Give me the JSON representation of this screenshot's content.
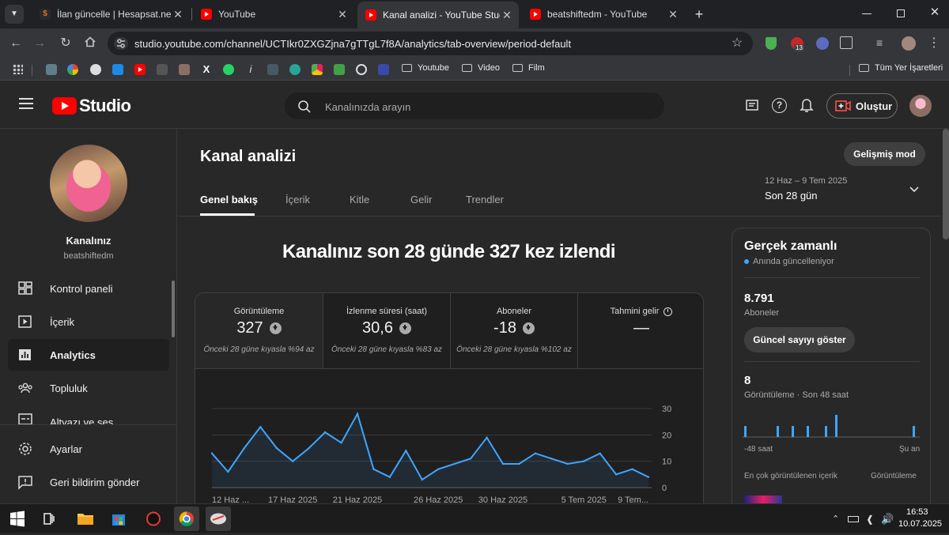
{
  "browser": {
    "tabs": [
      {
        "title": "İlan güncelle | Hesapsat.net",
        "favicon": "hesapsat-icon",
        "active": false
      },
      {
        "title": "YouTube",
        "favicon": "youtube-icon",
        "active": false
      },
      {
        "title": "Kanal analizi - YouTube Studio",
        "favicon": "youtube-icon",
        "active": true
      },
      {
        "title": "beatshiftedm - YouTube",
        "favicon": "youtube-icon",
        "active": false
      }
    ],
    "url": "studio.youtube.com/channel/UCTIkr0ZXGZjna7gTTgL7f8A/analytics/tab-overview/period-default",
    "extension_badge": "13",
    "bookmark_folders": [
      "Youtube",
      "Video",
      "Film"
    ],
    "all_bookmarks_label": "Tüm Yer İşaretleri"
  },
  "studio": {
    "logo_text": "Studio",
    "search_placeholder": "Kanalınızda arayın",
    "create_label": "Oluştur"
  },
  "sidebar": {
    "channel_title": "Kanalınız",
    "channel_handle": "beatshiftedm",
    "items": [
      {
        "label": "Kontrol paneli",
        "icon": "dashboard-icon"
      },
      {
        "label": "İçerik",
        "icon": "content-icon"
      },
      {
        "label": "Analytics",
        "icon": "analytics-icon"
      },
      {
        "label": "Topluluk",
        "icon": "community-icon"
      },
      {
        "label": "Altyazı ve ses",
        "icon": "subtitles-icon"
      }
    ],
    "bottom_items": [
      {
        "label": "Ayarlar",
        "icon": "gear-icon"
      },
      {
        "label": "Geri bildirim gönder",
        "icon": "feedback-icon"
      }
    ]
  },
  "main": {
    "page_title": "Kanal analizi",
    "advanced_mode_label": "Gelişmiş mod",
    "tabs": [
      "Genel bakış",
      "İçerik",
      "Kitle",
      "Gelir",
      "Trendler"
    ],
    "period_range": "12 Haz – 9 Tem 2025",
    "period_label": "Son 28 gün",
    "headline": "Kanalınız son 28 günde 327 kez izlendi",
    "metrics": [
      {
        "label": "Görüntüleme",
        "value": "327",
        "compare": "Önceki 28 güne kıyasla %94 az"
      },
      {
        "label": "İzlenme süresi (saat)",
        "value": "30,6",
        "compare": "Önceki 28 güne kıyasla %83 az"
      },
      {
        "label": "Aboneler",
        "value": "-18",
        "compare": "Önceki 28 güne kıyasla %102 az"
      },
      {
        "label": "Tahmini gelir",
        "value": "—",
        "compare": ""
      }
    ]
  },
  "realtime": {
    "title": "Gerçek zamanlı",
    "subtitle": "Anında güncelleniyor",
    "subscribers_value": "8.791",
    "subscribers_label": "Aboneler",
    "show_current_label": "Güncel sayıyı göster",
    "views_value": "8",
    "views_label": "Görüntüleme · Son 48 saat",
    "axis_start": "-48 saat",
    "axis_end": "Şu an",
    "top_content_label": "En çok görüntülenen içerik",
    "top_content_col": "Görüntüleme",
    "bars": [
      1,
      1,
      1,
      1,
      1,
      2,
      1
    ]
  },
  "chart_data": {
    "type": "area",
    "title": "",
    "x_tick_labels": [
      "12 Haz ...",
      "17 Haz 2025",
      "21 Haz 2025",
      "26 Haz 2025",
      "30 Haz 2025",
      "5 Tem 2025",
      "9 Tem..."
    ],
    "y_ticks": [
      0,
      10,
      20,
      30
    ],
    "ylim": [
      0,
      30
    ],
    "series": [
      {
        "values": [
          13,
          6,
          15,
          23,
          15,
          10,
          15,
          21,
          17,
          28,
          7,
          4,
          14,
          3,
          7,
          9,
          11,
          19,
          9,
          9,
          13,
          11,
          9,
          10,
          13,
          5,
          7,
          4
        ]
      }
    ],
    "grid": true
  },
  "taskbar": {
    "time": "16:53",
    "date": "10.07.2025"
  },
  "colors": {
    "accent_red": "#ff0000",
    "chart_line": "#3ea6ff",
    "realtime_bar": "#3ea6ff",
    "live_dot": "#3ea6ff"
  }
}
